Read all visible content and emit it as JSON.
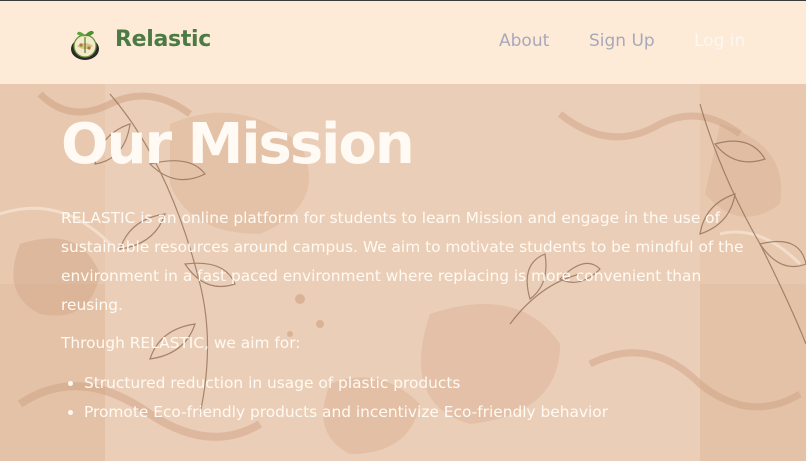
{
  "header": {
    "brand": "Relastic",
    "nav": {
      "about": "About",
      "signup": "Sign Up",
      "login": "Log in"
    }
  },
  "mission": {
    "title": "Our Mission",
    "paragraph": "RELASTIC is an online platform for students to learn Mission and engage in the use of sustainable resources around campus. We aim to motivate students to be mindful of the environment in a fast paced environment where replacing is more convenient than reusing.",
    "intro": "Through RELASTIC, we aim for:",
    "goals": [
      "Structured reduction in usage of plastic products",
      "Promote Eco-friendly products and incentivize Eco-friendly behavior"
    ]
  },
  "colors": {
    "header_bg": "#fdebd8",
    "brand": "#4c7a44",
    "nav_link": "#a8a8bb",
    "hero_bg": "#e9cbb3",
    "hero_text": "#fffaf3"
  },
  "icons": [
    "plant-globe-logo-icon",
    "leaf-branch-decoration-icon"
  ]
}
